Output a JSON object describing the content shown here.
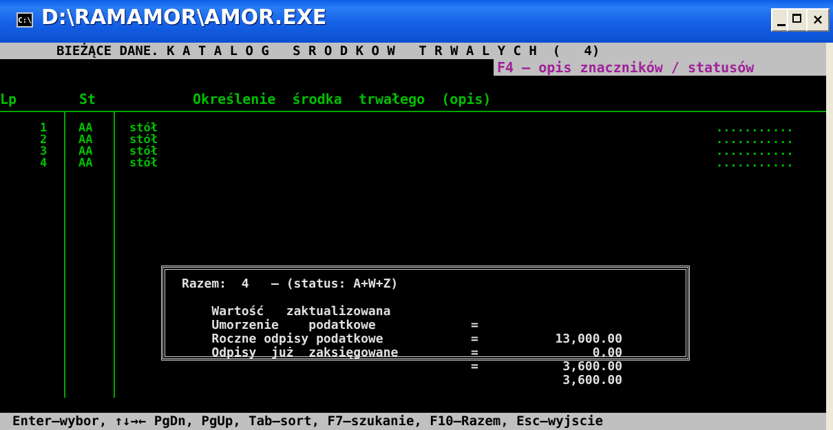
{
  "window": {
    "title": "D:\\RAMAMOR\\AMOR.EXE",
    "icon": "console-icon",
    "buttons": [
      "minimize",
      "maximize",
      "close"
    ],
    "close_glyph": "×"
  },
  "header": {
    "text": "BIEŻĄCE DANE. K A T A L O G   S R O D K O W   T R W A L Y C H  (   4)",
    "hint": "F4 – opis znaczników / statusów"
  },
  "columns": {
    "lp": "Lp",
    "st": "St",
    "desc": "Określenie  środka  trwałego  (opis)"
  },
  "rows": [
    {
      "lp": "1",
      "st": "AA",
      "desc": "stół",
      "dots": "..........."
    },
    {
      "lp": "2",
      "st": "AA",
      "desc": "stół",
      "dots": "..........."
    },
    {
      "lp": "3",
      "st": "AA",
      "desc": "stół",
      "dots": "..........."
    },
    {
      "lp": "4",
      "st": "AA",
      "desc": "stół",
      "dots": "..........."
    }
  ],
  "summary": {
    "title": "Razem:  4   – (status: A+W+Z)",
    "lines": [
      {
        "label": "Wartość   zaktualizowana",
        "eq": "=",
        "value": "13,000.00"
      },
      {
        "label": "Umorzenie    podatkowe",
        "eq": "=",
        "value": "0.00"
      },
      {
        "label": "Roczne odpisy podatkowe",
        "eq": "=",
        "value": "3,600.00"
      },
      {
        "label": "Odpisy  już  zaksięgowane",
        "eq": "=",
        "value": "3,600.00"
      }
    ]
  },
  "footer": "Enter–wybor, ↑↓→← PgDn, PgUp, Tab–sort, F7–szukanie, F10–Razem, Esc–wyjscie",
  "colors": {
    "green": "#00c000",
    "magenta": "#a0209a",
    "bar": "#c0c0c0",
    "title_blue": "#0b4fd1"
  }
}
